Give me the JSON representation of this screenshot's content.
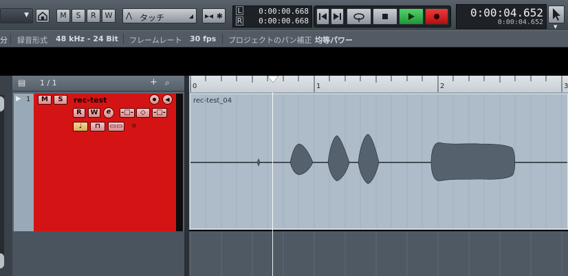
{
  "toolbar": {
    "mode_buttons": [
      "M",
      "S",
      "R",
      "W"
    ],
    "automation_mode": "タッチ",
    "locator_left_label": "L",
    "locator_right_label": "R",
    "locator_left": "0:00:00.668",
    "locator_right": "0:00:00.668",
    "time_display": "0:00:04.652",
    "time_display_secondary": "0:00:04.652"
  },
  "infobar": {
    "recording_format_label": "録音形式",
    "recording_format": "48 kHz - 24 Bit",
    "frame_rate_label": "フレームレート",
    "frame_rate": "30 fps",
    "pan_law_label": "プロジェクトのパン補正",
    "pan_law": "均等パワー",
    "left_cut": "分"
  },
  "tracklist": {
    "page_count": "1 / 1",
    "add_label": "+"
  },
  "track": {
    "number": "1",
    "mute": "M",
    "solo": "S",
    "name": "rec-test",
    "read": "R",
    "write": "W",
    "edit": "e",
    "slot_zero": "o"
  },
  "ruler": {
    "labels": [
      "0",
      "1",
      "2",
      "3"
    ]
  },
  "clip": {
    "name": "rec-test_04"
  },
  "colors": {
    "track_red": "#d41414",
    "play_green": "#2fb34a",
    "record_red": "#cc1111"
  }
}
